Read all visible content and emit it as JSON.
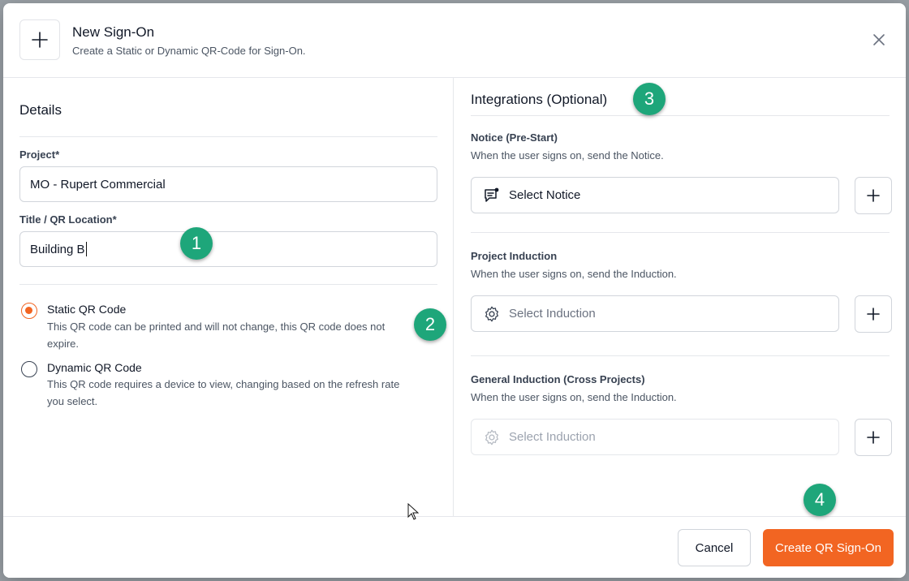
{
  "header": {
    "title": "New Sign-On",
    "subtitle": "Create a Static or Dynamic QR-Code for Sign-On.",
    "icon": "plus-icon",
    "close_icon": "close-icon"
  },
  "details": {
    "section_title": "Details",
    "project_label": "Project*",
    "project_value": "MO - Rupert Commercial",
    "title_label": "Title / QR Location*",
    "title_value": "Building B",
    "options": [
      {
        "title": "Static QR Code",
        "desc_line1": "This QR code can be printed and will not change, this QR code does not",
        "desc_line2": "expire.",
        "selected": true
      },
      {
        "title": "Dynamic QR Code",
        "desc_line1": "This QR code requires a device to view, changing based on the refresh rate",
        "desc_line2": "you select.",
        "selected": false
      }
    ]
  },
  "integrations": {
    "section_title": "Integrations (Optional)",
    "items": [
      {
        "label": "Notice (Pre-Start)",
        "desc": "When the user signs on, send the Notice.",
        "placeholder": "Select Notice",
        "icon": "notice-icon"
      },
      {
        "label": "Project Induction",
        "desc": "When the user signs on, send the Induction.",
        "placeholder": "Select Induction",
        "icon": "gear-icon"
      },
      {
        "label": "General Induction (Cross Projects)",
        "desc": "When the user signs on, send the Induction.",
        "placeholder": "Select Induction",
        "icon": "gear-icon"
      }
    ]
  },
  "footer": {
    "cancel_label": "Cancel",
    "create_label": "Create QR Sign-On"
  },
  "annotations": [
    "1",
    "2",
    "3",
    "4"
  ],
  "colors": {
    "accent": "#f26522",
    "badge": "#1ea67a"
  }
}
